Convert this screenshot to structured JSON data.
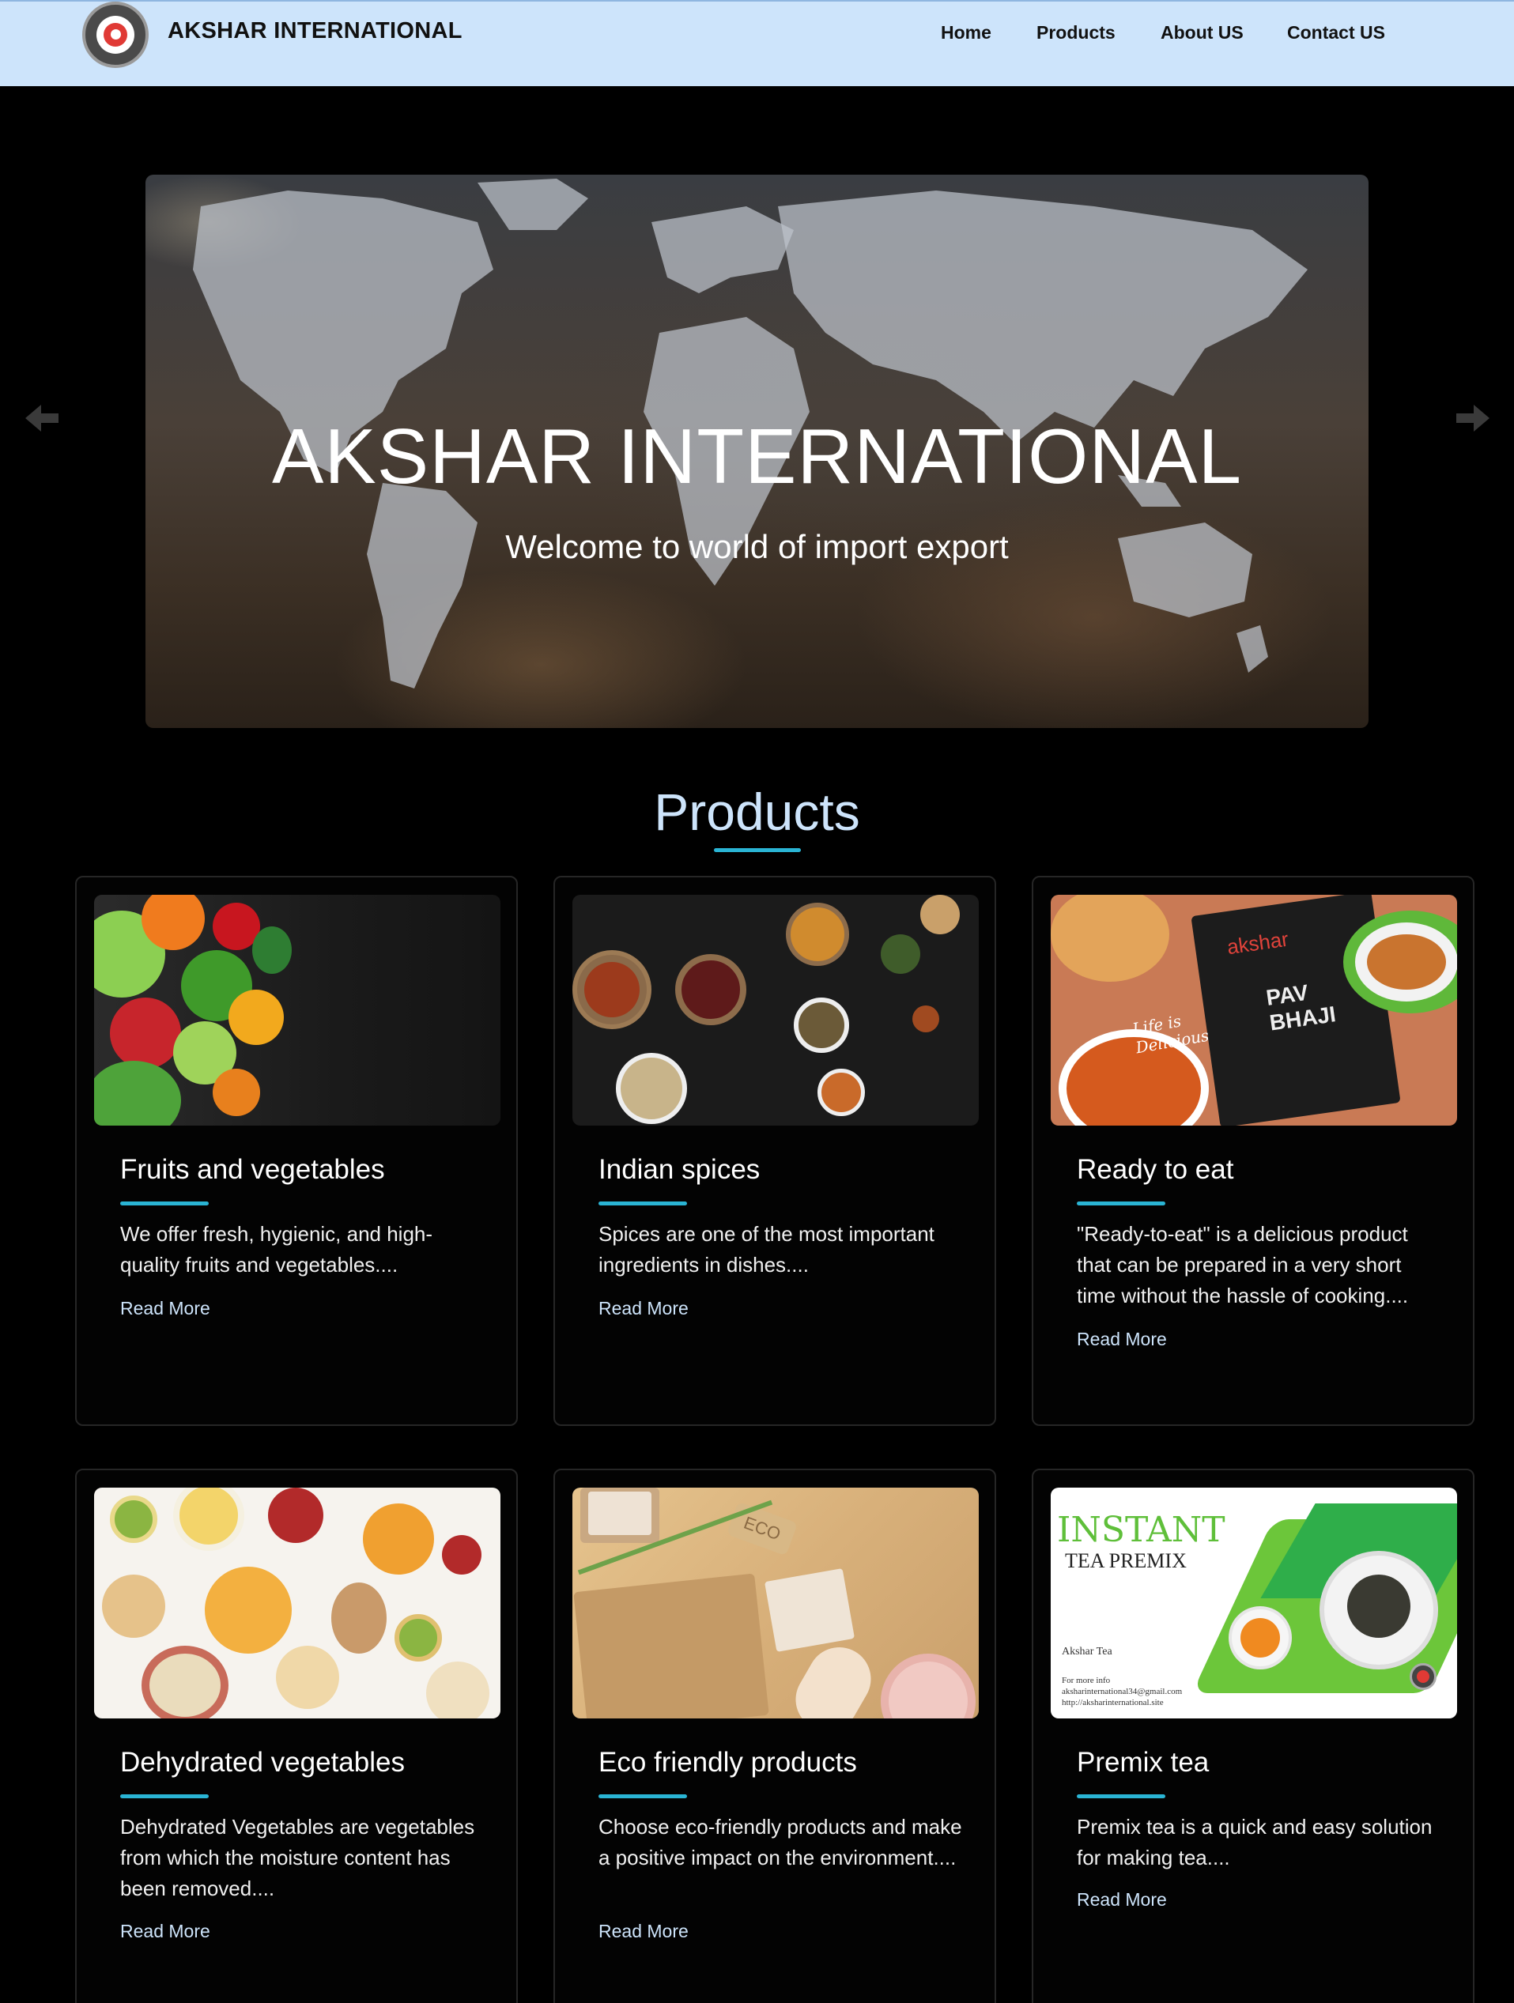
{
  "brand": {
    "name": "AKSHAR INTERNATIONAL"
  },
  "nav": {
    "home": "Home",
    "products": "Products",
    "about": "About US",
    "contact": "Contact US"
  },
  "hero": {
    "title": "AKSHAR INTERNATIONAL",
    "subtitle": "Welcome to world of import export"
  },
  "products": {
    "heading": "Products",
    "read_more": "Read More",
    "items": [
      {
        "title": "Fruits and vegetables",
        "desc": "We offer fresh, hygienic, and high-quality fruits and vegetables...."
      },
      {
        "title": "Indian spices",
        "desc": "Spices are one of the most important ingredients in dishes...."
      },
      {
        "title": "Ready to eat",
        "desc": "\"Ready-to-eat\" is a delicious product that can be prepared in a very short time without the hassle of cooking...."
      },
      {
        "title": "Dehydrated vegetables",
        "desc": "Dehydrated Vegetables are vegetables from which the moisture content has been removed...."
      },
      {
        "title": "Eco friendly products",
        "desc": "Choose eco-friendly products and make a positive impact on the environment...."
      },
      {
        "title": "Premix tea",
        "desc": "Premix tea is a quick and easy solution for making tea...."
      }
    ]
  },
  "packaging": {
    "ready_brand": "akshar",
    "ready_name_1": "PAV",
    "ready_name_2": "BHAJI",
    "ready_tagline": "Life is Delicious",
    "eco_tag": "ECO",
    "tea_line1": "INSTANT",
    "tea_line2": "TEA PREMIX",
    "tea_brand": "Akshar Tea",
    "tea_info": "For more info",
    "tea_email": "aksharinternational34@gmail.com",
    "tea_site": "http://aksharinternational.site"
  },
  "colors": {
    "nav_bg": "#cde4fb",
    "accent": "#2ab4d4",
    "heading": "#cde4fb",
    "background": "#000000"
  }
}
